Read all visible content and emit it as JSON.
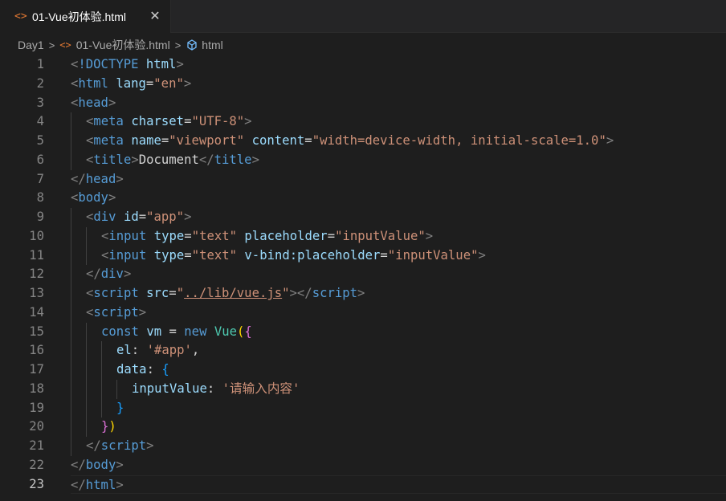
{
  "tab": {
    "label": "01-Vue初体验.html",
    "file_icon": "html-file-icon",
    "close_glyph": "✕"
  },
  "breadcrumb": {
    "folder": "Day1",
    "separator": ">",
    "file": "01-Vue初体验.html",
    "symbol": "html"
  },
  "colors": {
    "background": "#1e1e1e",
    "tag": "#569cd6",
    "attribute": "#9cdcfe",
    "string": "#ce9178",
    "punctuation": "#808080",
    "class": "#4ec9b0",
    "file_icon": "#e37933"
  },
  "editor": {
    "active_line": 23,
    "lines": [
      {
        "n": "1",
        "indent": 0,
        "tokens": [
          [
            "punc",
            "<"
          ],
          [
            "tag",
            "!DOCTYPE"
          ],
          [
            "text",
            " "
          ],
          [
            "attr",
            "html"
          ],
          [
            "punc",
            ">"
          ]
        ]
      },
      {
        "n": "2",
        "indent": 0,
        "tokens": [
          [
            "punc",
            "<"
          ],
          [
            "tag",
            "html"
          ],
          [
            "text",
            " "
          ],
          [
            "attr",
            "lang"
          ],
          [
            "text",
            "="
          ],
          [
            "str",
            "\"en\""
          ],
          [
            "punc",
            ">"
          ]
        ]
      },
      {
        "n": "3",
        "indent": 0,
        "tokens": [
          [
            "punc",
            "<"
          ],
          [
            "tag",
            "head"
          ],
          [
            "punc",
            ">"
          ]
        ]
      },
      {
        "n": "4",
        "indent": 1,
        "tokens": [
          [
            "punc",
            "<"
          ],
          [
            "tag",
            "meta"
          ],
          [
            "text",
            " "
          ],
          [
            "attr",
            "charset"
          ],
          [
            "text",
            "="
          ],
          [
            "str",
            "\"UTF-8\""
          ],
          [
            "punc",
            ">"
          ]
        ]
      },
      {
        "n": "5",
        "indent": 1,
        "tokens": [
          [
            "punc",
            "<"
          ],
          [
            "tag",
            "meta"
          ],
          [
            "text",
            " "
          ],
          [
            "attr",
            "name"
          ],
          [
            "text",
            "="
          ],
          [
            "str",
            "\"viewport\""
          ],
          [
            "text",
            " "
          ],
          [
            "attr",
            "content"
          ],
          [
            "text",
            "="
          ],
          [
            "str",
            "\"width=device-width, initial-scale=1.0\""
          ],
          [
            "punc",
            ">"
          ]
        ]
      },
      {
        "n": "6",
        "indent": 1,
        "tokens": [
          [
            "punc",
            "<"
          ],
          [
            "tag",
            "title"
          ],
          [
            "punc",
            ">"
          ],
          [
            "text",
            "Document"
          ],
          [
            "punc",
            "</"
          ],
          [
            "tag",
            "title"
          ],
          [
            "punc",
            ">"
          ]
        ]
      },
      {
        "n": "7",
        "indent": 0,
        "tokens": [
          [
            "punc",
            "</"
          ],
          [
            "tag",
            "head"
          ],
          [
            "punc",
            ">"
          ]
        ]
      },
      {
        "n": "8",
        "indent": 0,
        "tokens": [
          [
            "punc",
            "<"
          ],
          [
            "tag",
            "body"
          ],
          [
            "punc",
            ">"
          ]
        ]
      },
      {
        "n": "9",
        "indent": 1,
        "tokens": [
          [
            "punc",
            "<"
          ],
          [
            "tag",
            "div"
          ],
          [
            "text",
            " "
          ],
          [
            "attr",
            "id"
          ],
          [
            "text",
            "="
          ],
          [
            "str",
            "\"app\""
          ],
          [
            "punc",
            ">"
          ]
        ]
      },
      {
        "n": "10",
        "indent": 2,
        "tokens": [
          [
            "punc",
            "<"
          ],
          [
            "tag",
            "input"
          ],
          [
            "text",
            " "
          ],
          [
            "attr",
            "type"
          ],
          [
            "text",
            "="
          ],
          [
            "str",
            "\"text\""
          ],
          [
            "text",
            " "
          ],
          [
            "attr",
            "placeholder"
          ],
          [
            "text",
            "="
          ],
          [
            "str",
            "\"inputValue\""
          ],
          [
            "punc",
            ">"
          ]
        ]
      },
      {
        "n": "11",
        "indent": 2,
        "tokens": [
          [
            "punc",
            "<"
          ],
          [
            "tag",
            "input"
          ],
          [
            "text",
            " "
          ],
          [
            "attr",
            "type"
          ],
          [
            "text",
            "="
          ],
          [
            "str",
            "\"text\""
          ],
          [
            "text",
            " "
          ],
          [
            "attr",
            "v-bind:placeholder"
          ],
          [
            "text",
            "="
          ],
          [
            "str",
            "\"inputValue\""
          ],
          [
            "punc",
            ">"
          ]
        ]
      },
      {
        "n": "12",
        "indent": 1,
        "tokens": [
          [
            "punc",
            "</"
          ],
          [
            "tag",
            "div"
          ],
          [
            "punc",
            ">"
          ]
        ]
      },
      {
        "n": "13",
        "indent": 1,
        "tokens": [
          [
            "punc",
            "<"
          ],
          [
            "tag",
            "script"
          ],
          [
            "text",
            " "
          ],
          [
            "attr",
            "src"
          ],
          [
            "text",
            "="
          ],
          [
            "str",
            "\""
          ],
          [
            "strlink",
            "../lib/vue.js"
          ],
          [
            "str",
            "\""
          ],
          [
            "punc",
            "></"
          ],
          [
            "tag",
            "script"
          ],
          [
            "punc",
            ">"
          ]
        ]
      },
      {
        "n": "14",
        "indent": 1,
        "tokens": [
          [
            "punc",
            "<"
          ],
          [
            "tag",
            "script"
          ],
          [
            "punc",
            ">"
          ]
        ]
      },
      {
        "n": "15",
        "indent": 2,
        "tokens": [
          [
            "kw",
            "const"
          ],
          [
            "text",
            " "
          ],
          [
            "var",
            "vm"
          ],
          [
            "text",
            " = "
          ],
          [
            "kw",
            "new"
          ],
          [
            "text",
            " "
          ],
          [
            "cls",
            "Vue"
          ],
          [
            "b1",
            "("
          ],
          [
            "b2",
            "{"
          ]
        ]
      },
      {
        "n": "16",
        "indent": 3,
        "tokens": [
          [
            "var",
            "el"
          ],
          [
            "text",
            ": "
          ],
          [
            "str",
            "'#app'"
          ],
          [
            "text",
            ","
          ]
        ]
      },
      {
        "n": "17",
        "indent": 3,
        "tokens": [
          [
            "var",
            "data"
          ],
          [
            "text",
            ": "
          ],
          [
            "b3",
            "{"
          ]
        ]
      },
      {
        "n": "18",
        "indent": 4,
        "tokens": [
          [
            "var",
            "inputValue"
          ],
          [
            "text",
            ": "
          ],
          [
            "str",
            "'请输入内容'"
          ]
        ]
      },
      {
        "n": "19",
        "indent": 3,
        "tokens": [
          [
            "b3",
            "}"
          ]
        ]
      },
      {
        "n": "20",
        "indent": 2,
        "tokens": [
          [
            "b2",
            "}"
          ],
          [
            "b1",
            ")"
          ]
        ]
      },
      {
        "n": "21",
        "indent": 1,
        "tokens": [
          [
            "punc",
            "</"
          ],
          [
            "tag",
            "script"
          ],
          [
            "punc",
            ">"
          ]
        ]
      },
      {
        "n": "22",
        "indent": 0,
        "tokens": [
          [
            "punc",
            "</"
          ],
          [
            "tag",
            "body"
          ],
          [
            "punc",
            ">"
          ]
        ]
      },
      {
        "n": "23",
        "indent": 0,
        "tokens": [
          [
            "punc",
            "</"
          ],
          [
            "tag",
            "html"
          ],
          [
            "punc",
            ">"
          ]
        ]
      }
    ]
  }
}
